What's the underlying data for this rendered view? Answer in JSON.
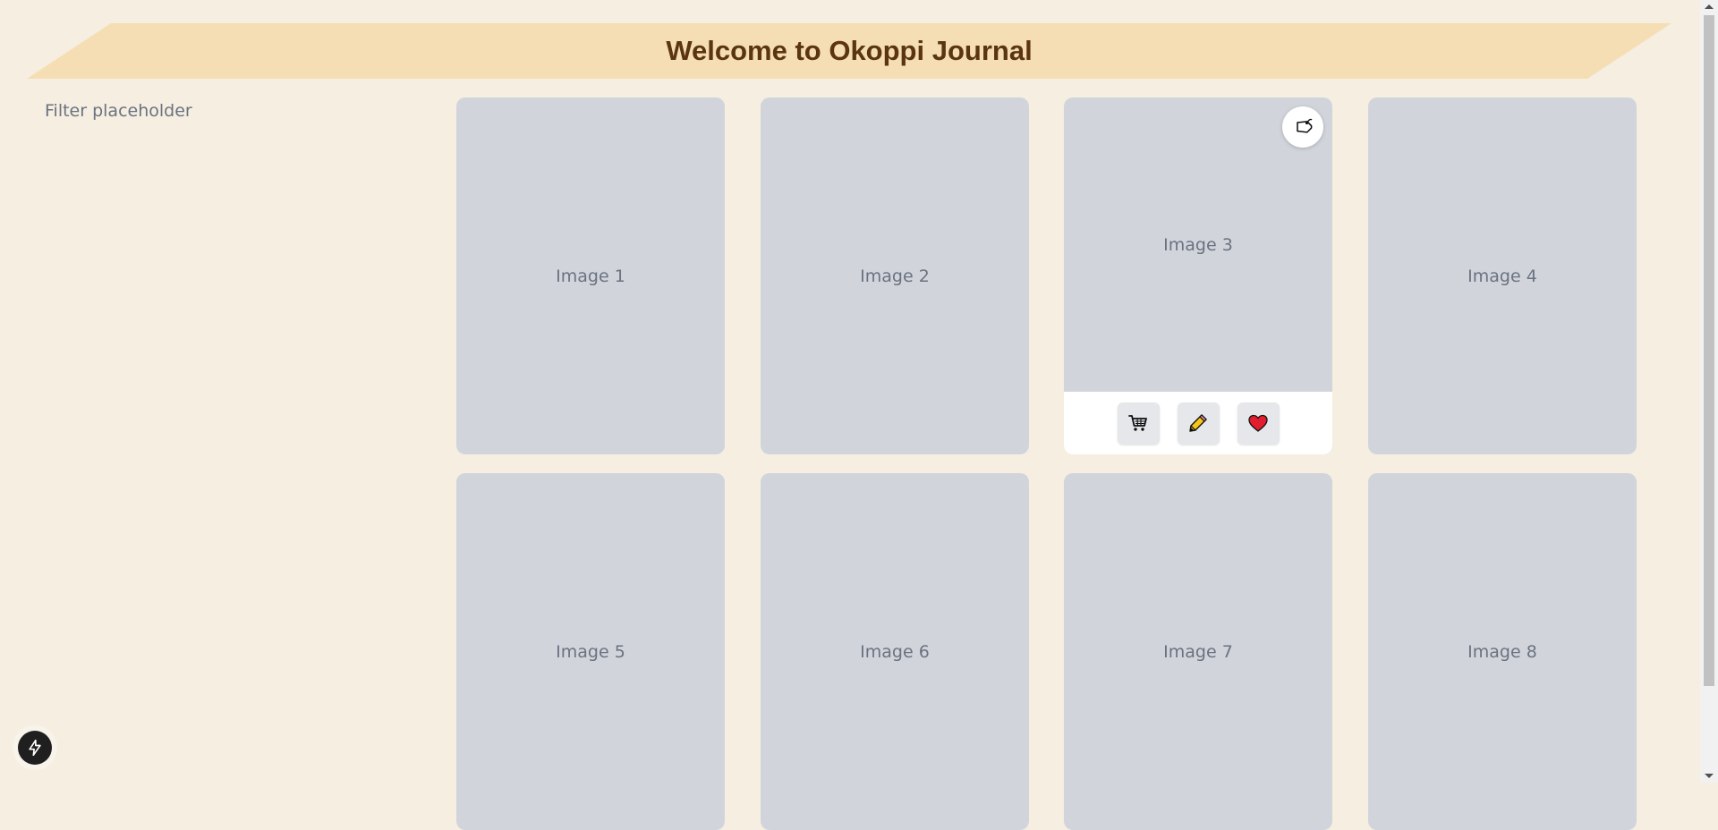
{
  "header": {
    "title": "Welcome to Okoppi Journal"
  },
  "filter": {
    "placeholder_text": "Filter placeholder"
  },
  "cards": [
    {
      "label": "Image 1"
    },
    {
      "label": "Image 2"
    },
    {
      "label": "Image 3"
    },
    {
      "label": "Image 4"
    },
    {
      "label": "Image 5"
    },
    {
      "label": "Image 6"
    },
    {
      "label": "Image 7"
    },
    {
      "label": "Image 8"
    }
  ],
  "card_actions": {
    "tag_icon": "tag-icon",
    "buttons": [
      "shopping-cart-icon",
      "pencil-icon",
      "heart-icon"
    ]
  },
  "floating_button": {
    "icon": "lightning-icon"
  },
  "colors": {
    "background": "#f5eee1",
    "banner": "#f5deb3",
    "title": "#5b3511",
    "card": "#d1d5db",
    "heart": "#e11d2e"
  }
}
